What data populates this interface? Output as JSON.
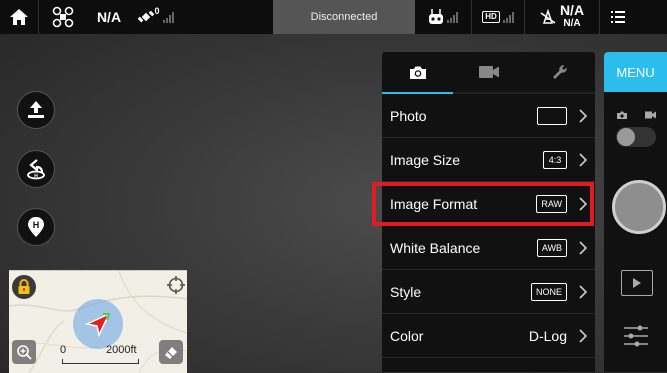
{
  "topbar": {
    "aircraft_mode": "N/A",
    "gps_count": "0",
    "connection_status": "Disconnected",
    "video_badge": "HD",
    "battery_top": "N/A",
    "battery_bottom": "N/A"
  },
  "left_controls": {
    "icons": [
      "takeoff-icon",
      "return-home-icon",
      "home-point-icon"
    ],
    "home_marker_letter": "H"
  },
  "minimap": {
    "scale_start": "0",
    "scale_end": "2000ft"
  },
  "camera_panel": {
    "tabs": [
      {
        "icon": "camera-icon",
        "active": true
      },
      {
        "icon": "video-camera-icon",
        "active": false
      },
      {
        "icon": "wrench-icon",
        "active": false
      }
    ],
    "rows": [
      {
        "label": "Photo",
        "value": "",
        "value_style": "box"
      },
      {
        "label": "Image Size",
        "value": "4:3",
        "value_style": "box"
      },
      {
        "label": "Image Format",
        "value": "RAW",
        "value_style": "box",
        "highlighted": true
      },
      {
        "label": "White Balance",
        "value": "AWB",
        "value_style": "box"
      },
      {
        "label": "Style",
        "value": "NONE",
        "value_style": "box"
      },
      {
        "label": "Color",
        "value": "D-Log",
        "value_style": "text"
      }
    ]
  },
  "capture_sidebar": {
    "menu_label": "MENU"
  },
  "colors": {
    "accent": "#2bbdeb",
    "highlight": "#e01b24"
  }
}
